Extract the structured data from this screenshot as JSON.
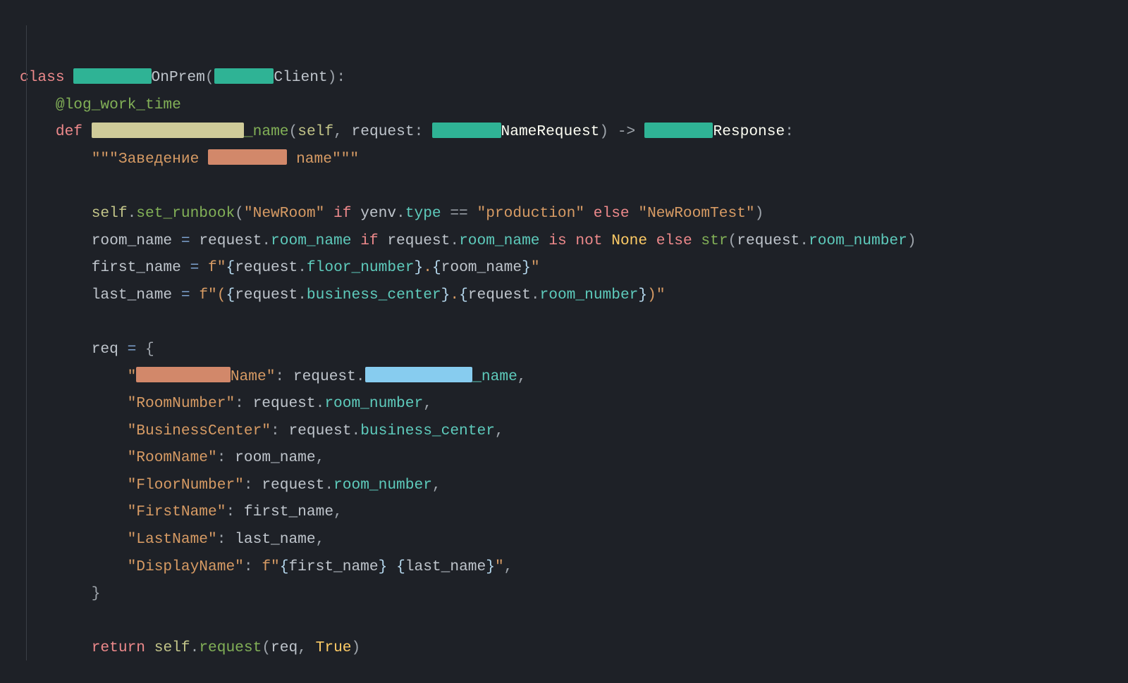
{
  "redactions": {
    "teal": "#2fb395",
    "olive": "#cfcb99",
    "brown": "#d2886a",
    "blue": "#87ccef"
  },
  "code": {
    "line01": {
      "kw_class": "class",
      "suffix_onprem": "OnPrem",
      "open_paren": "(",
      "suffix_client": "Client",
      "close": "):"
    },
    "line02": {
      "decorator": "@log_work_time"
    },
    "line03": {
      "kw_def": "def ",
      "suffix_name": "_name",
      "args_open": "(",
      "self": "self",
      "comma": ", ",
      "arg": "request",
      "colon": ": ",
      "suffix_namerequest": "NameRequest",
      "arrow": ") -> ",
      "suffix_response": "Response",
      "end": ":"
    },
    "line04": {
      "doc_open": "\"\"\"Заведение ",
      "doc_close": " name\"\"\""
    },
    "line05": {
      "self": "self",
      "dot": ".",
      "method": "set_runbook",
      "open": "(",
      "str1": "\"NewRoom\"",
      "kw_if": " if ",
      "ident_yenv": "yenv",
      "dot2": ".",
      "attr_type": "type",
      "eq": " == ",
      "str2": "\"production\"",
      "kw_else": " else ",
      "str3": "\"NewRoomTest\"",
      "close": ")"
    },
    "line06": {
      "var": "room_name",
      "assign": " = ",
      "ident_request": "request",
      "dot": ".",
      "attr_room_name": "room_name",
      "kw_if": " if ",
      "ident_request2": "request",
      "dot2": ".",
      "attr_room_name2": "room_name",
      "kw_is": " is ",
      "kw_not": "not ",
      "none": "None",
      "kw_else": " else ",
      "fn_str": "str",
      "open": "(",
      "ident_request3": "request",
      "dot3": ".",
      "attr_room_number": "room_number",
      "close": ")"
    },
    "line07": {
      "var": "first_name",
      "assign": " = ",
      "fprefix": "f",
      "quote_open": "\"",
      "brace_o": "{",
      "ident_request": "request",
      "dot": ".",
      "attr_floor": "floor_number",
      "brace_c": "}",
      "dot_str": ".",
      "brace_o2": "{",
      "ident_room": "room_name",
      "brace_c2": "}",
      "quote_close": "\""
    },
    "line08": {
      "var": "last_name",
      "assign": " = ",
      "fprefix": "f",
      "quote_open": "\"",
      "paren_str": "(",
      "brace_o": "{",
      "ident_request": "request",
      "dot": ".",
      "attr_bc": "business_center",
      "brace_c": "}",
      "dot_str": ".",
      "brace_o2": "{",
      "ident_request2": "request",
      "dot2": ".",
      "attr_rn": "room_number",
      "brace_c2": "}",
      "paren_str2": ")",
      "quote_close": "\""
    },
    "line09": {
      "var": "req",
      "assign": " = ",
      "brace": "{"
    },
    "line10": {
      "quote_o": "\"",
      "suffix_key": "Name\"",
      "colon": ": ",
      "ident_request": "request",
      "dot": ".",
      "suffix_attr": "_name",
      "comma": ","
    },
    "line11": {
      "key": "\"RoomNumber\"",
      "colon": ": ",
      "ident_request": "request",
      "dot": ".",
      "attr": "room_number",
      "comma": ","
    },
    "line12": {
      "key": "\"BusinessCenter\"",
      "colon": ": ",
      "ident_request": "request",
      "dot": ".",
      "attr": "business_center",
      "comma": ","
    },
    "line13": {
      "key": "\"RoomName\"",
      "colon": ": ",
      "ident": "room_name",
      "comma": ","
    },
    "line14": {
      "key": "\"FloorNumber\"",
      "colon": ": ",
      "ident_request": "request",
      "dot": ".",
      "attr": "room_number",
      "comma": ","
    },
    "line15": {
      "key": "\"FirstName\"",
      "colon": ": ",
      "ident": "first_name",
      "comma": ","
    },
    "line16": {
      "key": "\"LastName\"",
      "colon": ": ",
      "ident": "last_name",
      "comma": ","
    },
    "line17": {
      "key": "\"DisplayName\"",
      "colon": ": ",
      "fprefix": "f",
      "quote_open": "\"",
      "brace_o": "{",
      "ident1": "first_name",
      "brace_c": "}",
      "space": " ",
      "brace_o2": "{",
      "ident2": "last_name",
      "brace_c2": "}",
      "quote_close": "\"",
      "comma": ","
    },
    "line18": {
      "brace": "}"
    },
    "line19": {
      "kw_return": "return",
      "sp": " ",
      "self": "self",
      "dot": ".",
      "method": "request",
      "open": "(",
      "arg1": "req",
      "comma": ", ",
      "true": "True",
      "close": ")"
    }
  }
}
